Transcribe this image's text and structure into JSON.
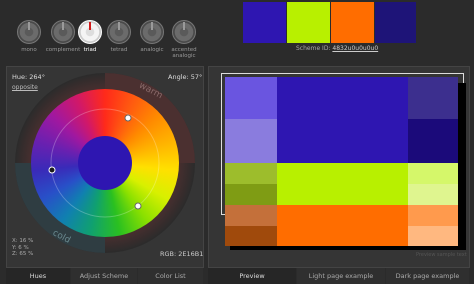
{
  "scheme_types": [
    {
      "label": "mono",
      "active": false
    },
    {
      "label": "complement",
      "active": false
    },
    {
      "label": "triad",
      "active": true
    },
    {
      "label": "tetrad",
      "active": false
    },
    {
      "label": "analogic",
      "active": false
    },
    {
      "label": "accented\nanalogic",
      "active": false
    }
  ],
  "swatches": [
    "#2e16b1",
    "#b8f000",
    "#ff6d00",
    "#1e1478"
  ],
  "scheme_id_label": "Scheme ID:",
  "scheme_id": "4832u0u0u0u0",
  "hue_label": "Hue:",
  "hue_value": "264°",
  "opposite_link": "opposite",
  "angle_label": "Angle:",
  "angle_value": "57°",
  "warm_label": "warm",
  "cold_label": "cold",
  "xyz": "X: 16 %\nY: 6 %\nZ: 65 %",
  "rgb_label": "RGB:",
  "rgb_value": "2E16B1",
  "left_tabs": [
    "Hues",
    "Adjust Scheme",
    "Color List"
  ],
  "right_tabs": [
    "Preview",
    "Light page example",
    "Dark page example"
  ],
  "preview_watermark": "Preview sample text",
  "colors": {
    "primary": [
      "#2e16b1",
      "#6a55e0",
      "#8a7cde",
      "#1b0a7a",
      "#3c2f8e"
    ],
    "secondary": [
      "#b8f000",
      "#9dbd2c",
      "#7f9c14",
      "#d5f76a",
      "#dff58f"
    ],
    "tertiary": [
      "#ff6d00",
      "#c4703a",
      "#a04a0c",
      "#ff9a4d",
      "#ffb880"
    ]
  }
}
